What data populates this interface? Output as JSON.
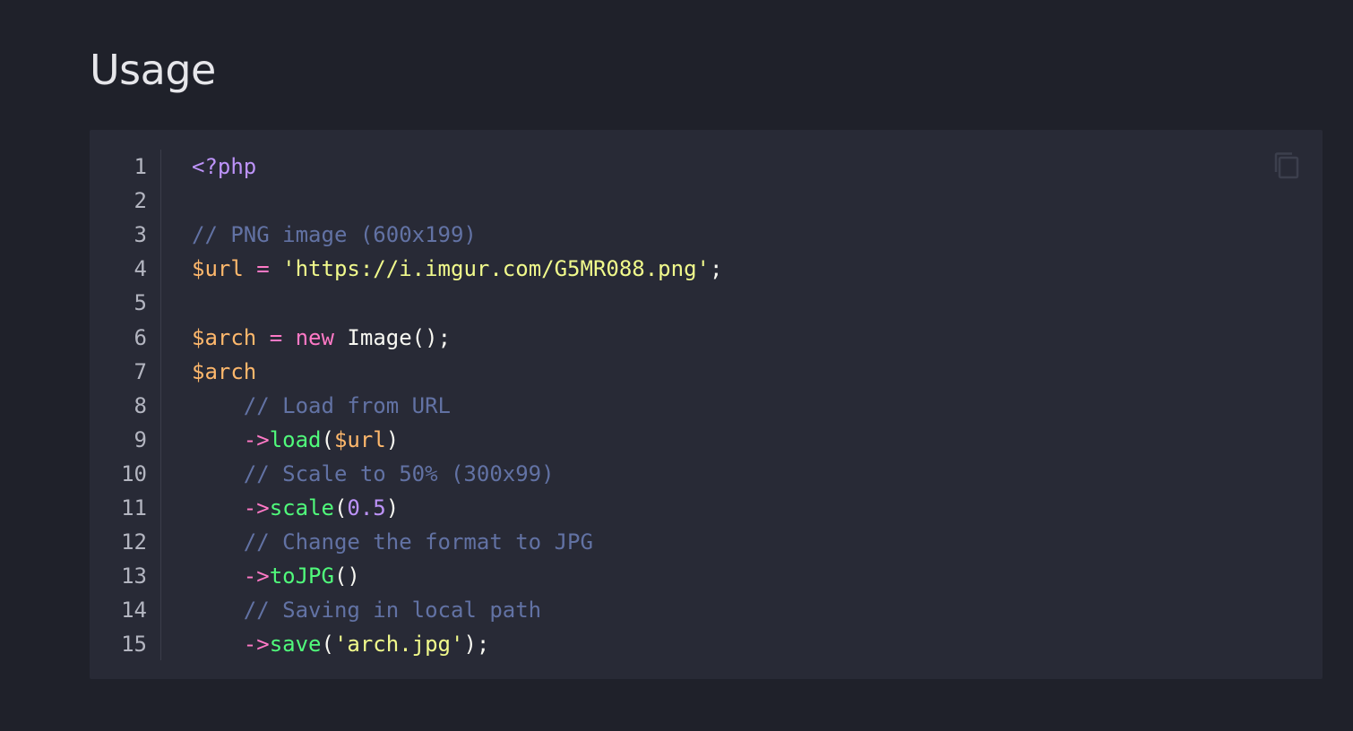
{
  "section": {
    "title": "Usage"
  },
  "code_block": {
    "copy_icon": "copy-icon",
    "language": "php",
    "lines": [
      {
        "num": "1",
        "tokens": [
          {
            "t": "<?php",
            "k": "tag"
          }
        ]
      },
      {
        "num": "2",
        "tokens": []
      },
      {
        "num": "3",
        "tokens": [
          {
            "t": "// PNG image (600x199)",
            "k": "comment"
          }
        ]
      },
      {
        "num": "4",
        "tokens": [
          {
            "t": "$url",
            "k": "var"
          },
          {
            "t": " ",
            "k": "plain"
          },
          {
            "t": "=",
            "k": "op"
          },
          {
            "t": " ",
            "k": "plain"
          },
          {
            "t": "'https://i.imgur.com/G5MR088.png'",
            "k": "str"
          },
          {
            "t": ";",
            "k": "plain"
          }
        ]
      },
      {
        "num": "5",
        "tokens": []
      },
      {
        "num": "6",
        "tokens": [
          {
            "t": "$arch",
            "k": "var"
          },
          {
            "t": " ",
            "k": "plain"
          },
          {
            "t": "=",
            "k": "op"
          },
          {
            "t": " ",
            "k": "plain"
          },
          {
            "t": "new",
            "k": "kw"
          },
          {
            "t": " Image();",
            "k": "plain"
          }
        ]
      },
      {
        "num": "7",
        "tokens": [
          {
            "t": "$arch",
            "k": "var"
          }
        ]
      },
      {
        "num": "8",
        "tokens": [
          {
            "t": "    ",
            "k": "plain"
          },
          {
            "t": "// Load from URL",
            "k": "comment"
          }
        ]
      },
      {
        "num": "9",
        "tokens": [
          {
            "t": "    ",
            "k": "plain"
          },
          {
            "t": "->",
            "k": "op"
          },
          {
            "t": "load",
            "k": "fn"
          },
          {
            "t": "(",
            "k": "plain"
          },
          {
            "t": "$url",
            "k": "var"
          },
          {
            "t": ")",
            "k": "plain"
          }
        ]
      },
      {
        "num": "10",
        "tokens": [
          {
            "t": "    ",
            "k": "plain"
          },
          {
            "t": "// Scale to 50% (300x99)",
            "k": "comment"
          }
        ]
      },
      {
        "num": "11",
        "tokens": [
          {
            "t": "    ",
            "k": "plain"
          },
          {
            "t": "->",
            "k": "op"
          },
          {
            "t": "scale",
            "k": "fn"
          },
          {
            "t": "(",
            "k": "plain"
          },
          {
            "t": "0.5",
            "k": "num"
          },
          {
            "t": ")",
            "k": "plain"
          }
        ]
      },
      {
        "num": "12",
        "tokens": [
          {
            "t": "    ",
            "k": "plain"
          },
          {
            "t": "// Change the format to JPG",
            "k": "comment"
          }
        ]
      },
      {
        "num": "13",
        "tokens": [
          {
            "t": "    ",
            "k": "plain"
          },
          {
            "t": "->",
            "k": "op"
          },
          {
            "t": "toJPG",
            "k": "fn"
          },
          {
            "t": "()",
            "k": "plain"
          }
        ]
      },
      {
        "num": "14",
        "tokens": [
          {
            "t": "    ",
            "k": "plain"
          },
          {
            "t": "// Saving in local path",
            "k": "comment"
          }
        ]
      },
      {
        "num": "15",
        "tokens": [
          {
            "t": "    ",
            "k": "plain"
          },
          {
            "t": "->",
            "k": "op"
          },
          {
            "t": "save",
            "k": "fn"
          },
          {
            "t": "(",
            "k": "plain"
          },
          {
            "t": "'arch.jpg'",
            "k": "str"
          },
          {
            "t": ");",
            "k": "plain"
          }
        ]
      }
    ]
  },
  "colors": {
    "background": "#1f212a",
    "code_background": "#282a36",
    "tag": "#bd93f9",
    "comment": "#6272a4",
    "variable": "#ffb86c",
    "operator": "#ff79c6",
    "string": "#f1fa8c",
    "function": "#50fa7b",
    "number": "#bd93f9"
  }
}
